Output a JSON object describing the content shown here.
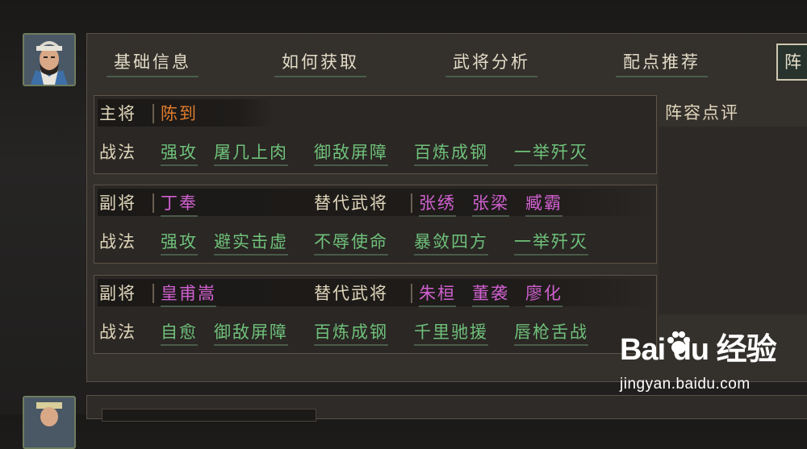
{
  "tabs": [
    "基础信息",
    "如何获取",
    "武将分析",
    "配点推荐"
  ],
  "active_tab": "阵",
  "main_general": {
    "role_label": "主将",
    "name": "陈到",
    "skills_label": "战法",
    "skills": [
      "强攻",
      "屠几上肉",
      "御敌屏障",
      "百炼成钢",
      "一举歼灭"
    ]
  },
  "vice_generals": [
    {
      "role_label": "副将",
      "name": "丁奉",
      "alt_label": "替代武将",
      "alternatives": [
        "张绣",
        "张梁",
        "臧霸"
      ],
      "skills_label": "战法",
      "skills": [
        "强攻",
        "避实击虚",
        "不辱使命",
        "暴敛四方",
        "一举歼灭"
      ]
    },
    {
      "role_label": "副将",
      "name": "皇甫嵩",
      "alt_label": "替代武将",
      "alternatives": [
        "朱桓",
        "董袭",
        "廖化"
      ],
      "skills_label": "战法",
      "skills": [
        "自愈",
        "御敌屏障",
        "百炼成钢",
        "千里驰援",
        "唇枪舌战"
      ]
    }
  ],
  "review": {
    "title": "阵容点评"
  },
  "watermark": {
    "logo": "Bai du 经验",
    "url": "jingyan.baidu.com"
  },
  "colors": {
    "main_name": "#e07c2c",
    "alt_name": "#d060d0",
    "skill": "#6fc07a",
    "label": "#e0d6bb"
  }
}
